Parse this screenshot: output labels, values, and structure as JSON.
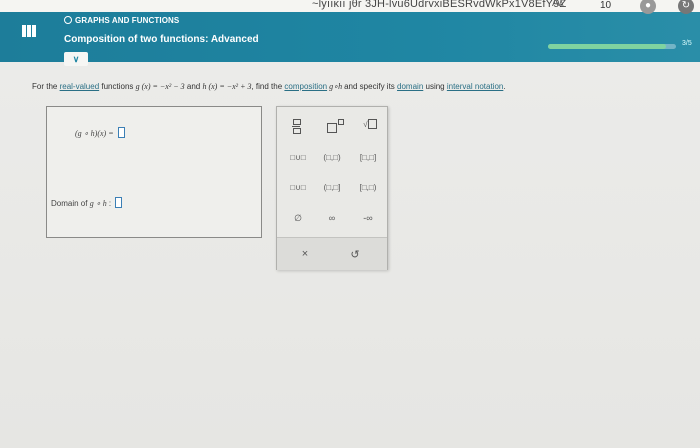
{
  "browser": {
    "url_fragment": "~lyııκıı jθr 3JH-lvu6UdrvxiBESRvdWkPx1V8EfY9Z",
    "caption": "Aᴀ",
    "tab_count": "10"
  },
  "header": {
    "topic": "GRAPHS AND FUNCTIONS",
    "title": "Composition of two functions: Advanced",
    "progress_fraction": 0.92,
    "progress_label": "3/5"
  },
  "question": {
    "lead": "For the ",
    "real_valued_link": "real-valued",
    "part1": " functions ",
    "g_def": "g (x) = −x² − 3",
    "and": " and ",
    "h_def": "h (x) = −x² + 3",
    "part2": ", find the ",
    "composition_link": "composition",
    "g_circ_h": " g∘h ",
    "part3": "and specify its ",
    "domain_link": "domain",
    "part4": " using ",
    "interval_link": "interval notation",
    "end": "."
  },
  "answer": {
    "comp_label": "(g ∘ h)(x) =",
    "domain_label": "Domain of ",
    "domain_fn": "g ∘ h",
    "domain_colon": " :"
  },
  "keypad": {
    "row2": [
      "□∪□",
      "(□,□)",
      "[□,□]"
    ],
    "row3": [
      "□∪□",
      "(□,□]",
      "[□,□)"
    ],
    "row4": [
      "∅",
      "∞",
      "-∞"
    ],
    "clear": "×",
    "undo": "↺"
  },
  "colors": {
    "header": "#1f86a3",
    "progress": "#7fd3a0",
    "answer_slot": "#3b7fb5"
  }
}
